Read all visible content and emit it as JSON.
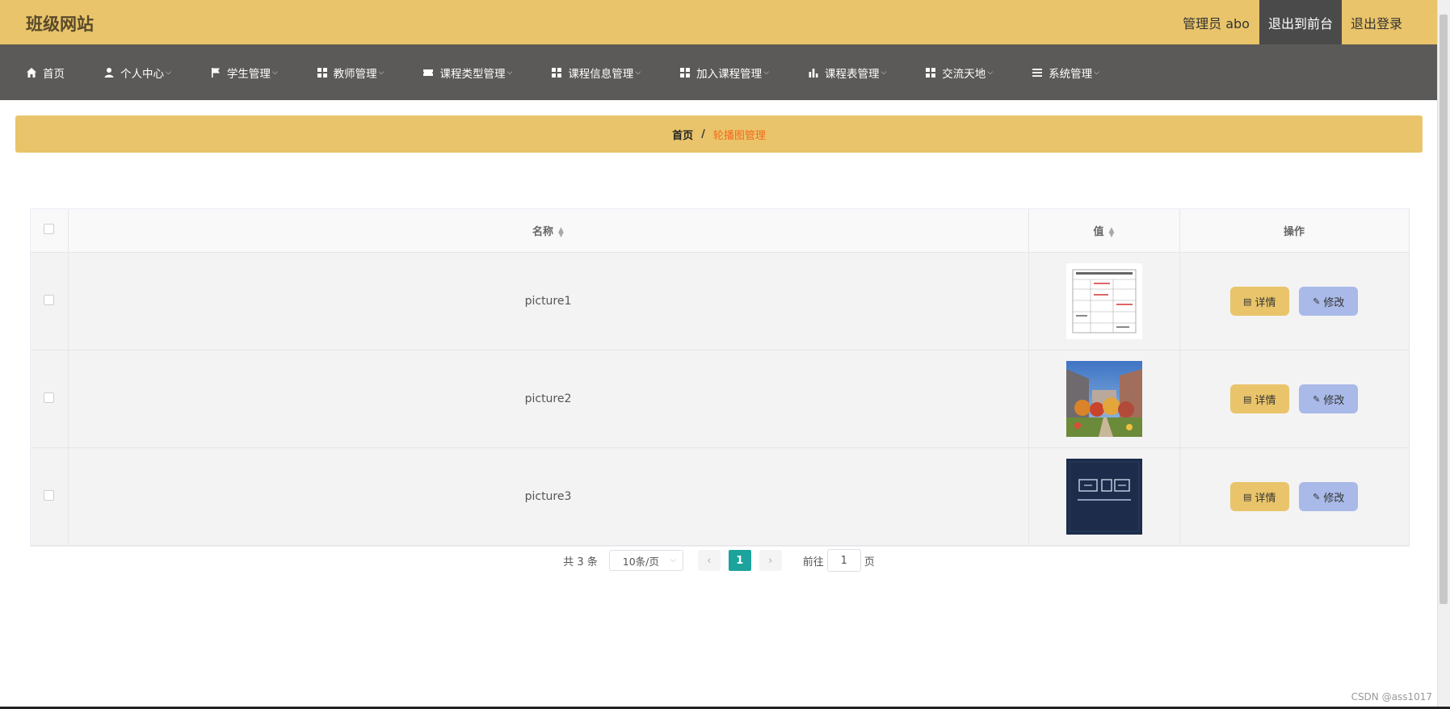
{
  "header": {
    "site_title": "班级网站",
    "admin_label": "管理员 abo",
    "to_front_label": "退出到前台",
    "logout_label": "退出登录"
  },
  "nav": [
    {
      "label": "首页",
      "icon": "home-icon",
      "dropdown": false
    },
    {
      "label": "个人中心",
      "icon": "user-icon",
      "dropdown": true
    },
    {
      "label": "学生管理",
      "icon": "flag-icon",
      "dropdown": true
    },
    {
      "label": "教师管理",
      "icon": "grid-icon",
      "dropdown": true
    },
    {
      "label": "课程类型管理",
      "icon": "ticket-icon",
      "dropdown": true
    },
    {
      "label": "课程信息管理",
      "icon": "grid-icon",
      "dropdown": true
    },
    {
      "label": "加入课程管理",
      "icon": "grid-icon",
      "dropdown": true
    },
    {
      "label": "课程表管理",
      "icon": "bar-chart-icon",
      "dropdown": true
    },
    {
      "label": "交流天地",
      "icon": "grid-icon",
      "dropdown": true
    },
    {
      "label": "系统管理",
      "icon": "list-icon",
      "dropdown": true
    }
  ],
  "breadcrumb": {
    "home": "首页",
    "separator": "/",
    "current": "轮播图管理"
  },
  "table": {
    "headers": {
      "name": "名称",
      "value": "值",
      "actions": "操作"
    },
    "rows": [
      {
        "name": "picture1",
        "thumb": "document-form-image"
      },
      {
        "name": "picture2",
        "thumb": "campus-photo-image"
      },
      {
        "name": "picture3",
        "thumb": "dark-book-cover-image"
      }
    ],
    "detail_label": "详情",
    "edit_label": "修改"
  },
  "pagination": {
    "total_text": "共 3 条",
    "page_size": "10条/页",
    "current_page": "1",
    "goto_prefix": "前往",
    "goto_value": "1",
    "goto_suffix": "页"
  },
  "watermark": "CSDN @ass1017",
  "colors": {
    "header_bg": "#e9c46a",
    "nav_bg": "#5b5a58",
    "accent_orange": "#f26b1d",
    "page_active": "#1ba39c",
    "edit_button": "#a9b9e8"
  }
}
